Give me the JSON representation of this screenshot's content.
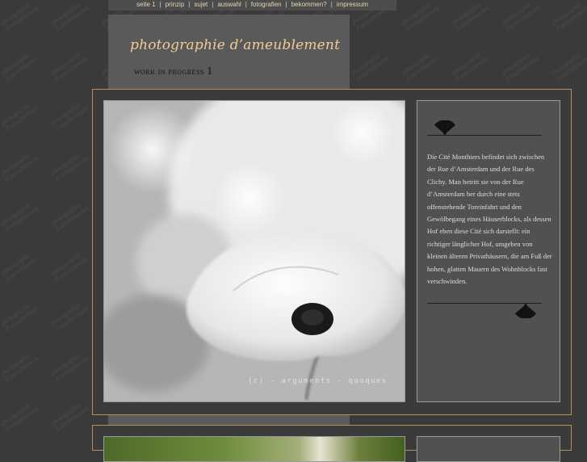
{
  "nav": {
    "items": [
      {
        "label": "seite 1"
      },
      {
        "label": "prinzip"
      },
      {
        "label": "sujet"
      },
      {
        "label": "auswahl"
      },
      {
        "label": "fotografien"
      },
      {
        "label": "bekommen?"
      },
      {
        "label": "impressum"
      }
    ],
    "separator": "|"
  },
  "header": {
    "title": "photographie d’ameublement",
    "subtitle": "work in progress",
    "subtitle_number": "1"
  },
  "background_watermark": [
    "photographie",
    "d'ameublement"
  ],
  "entry": {
    "photo_watermark": "(c) - arguments - quoques",
    "description": "Die Cité Monthiers befindet sich zwischen der Rue d’Amsterdam und der Rue des Clichy. Man betritt sie von der Rue d’Amsterdam her durch eine stets offenstehende Toreinfahrt und den Gewölbegang eines Häuserblocks, als dessen Hof eben diese Cité sich darstellt: ein richtiger länglicher Hof, umgeben von kleinen älteren Privathäusern, die am Fuß der hohen, glatten Mauern des Wohnblocks fast verschwinden."
  },
  "colors": {
    "background": "#3a3a3a",
    "panel": "#5a5a5a",
    "accent_gold": "#f2cc97",
    "frame_border": "#b58d5e"
  }
}
